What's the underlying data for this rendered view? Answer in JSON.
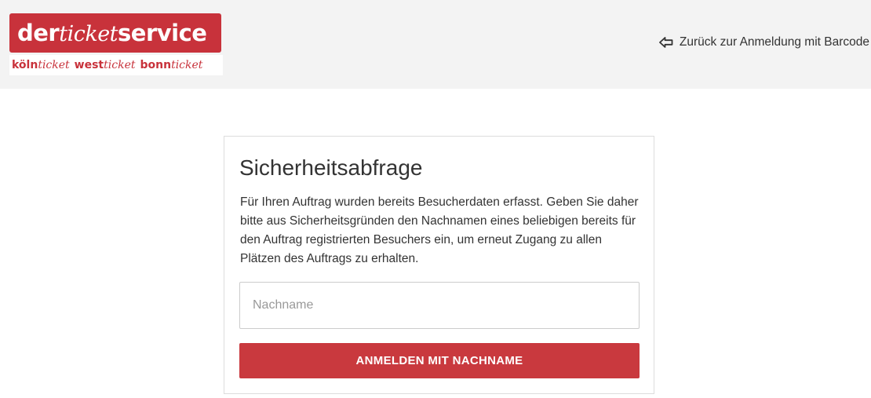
{
  "header": {
    "logo": {
      "part1": "der",
      "part2": "ticket",
      "part3": "service",
      "sub1_bold": "köln",
      "sub1_script": "ticket",
      "sub2_bold": "west",
      "sub2_script": "ticket",
      "sub3_bold": "bonn",
      "sub3_script": "ticket"
    },
    "back_link": {
      "icon": "arrow-left-outline-icon",
      "label": "Zurück zur Anmeldung mit Barcode"
    }
  },
  "card": {
    "title": "Sicherheitsabfrage",
    "description": "Für Ihren Auftrag wurden bereits Besucherdaten erfasst. Geben Sie daher bitte aus Sicherheitsgründen den Nachnamen eines beliebigen bereits für den Auftrag registrierten Besuchers ein, um erneut Zugang zu allen Plätzen des Auftrags zu erhalten.",
    "input": {
      "value": "",
      "placeholder": "Nachname"
    },
    "button_label": "ANMELDEN MIT NACHNAME"
  },
  "colors": {
    "brand_red": "#c8323b",
    "header_bg": "#f3f3f3",
    "text": "#333333"
  }
}
